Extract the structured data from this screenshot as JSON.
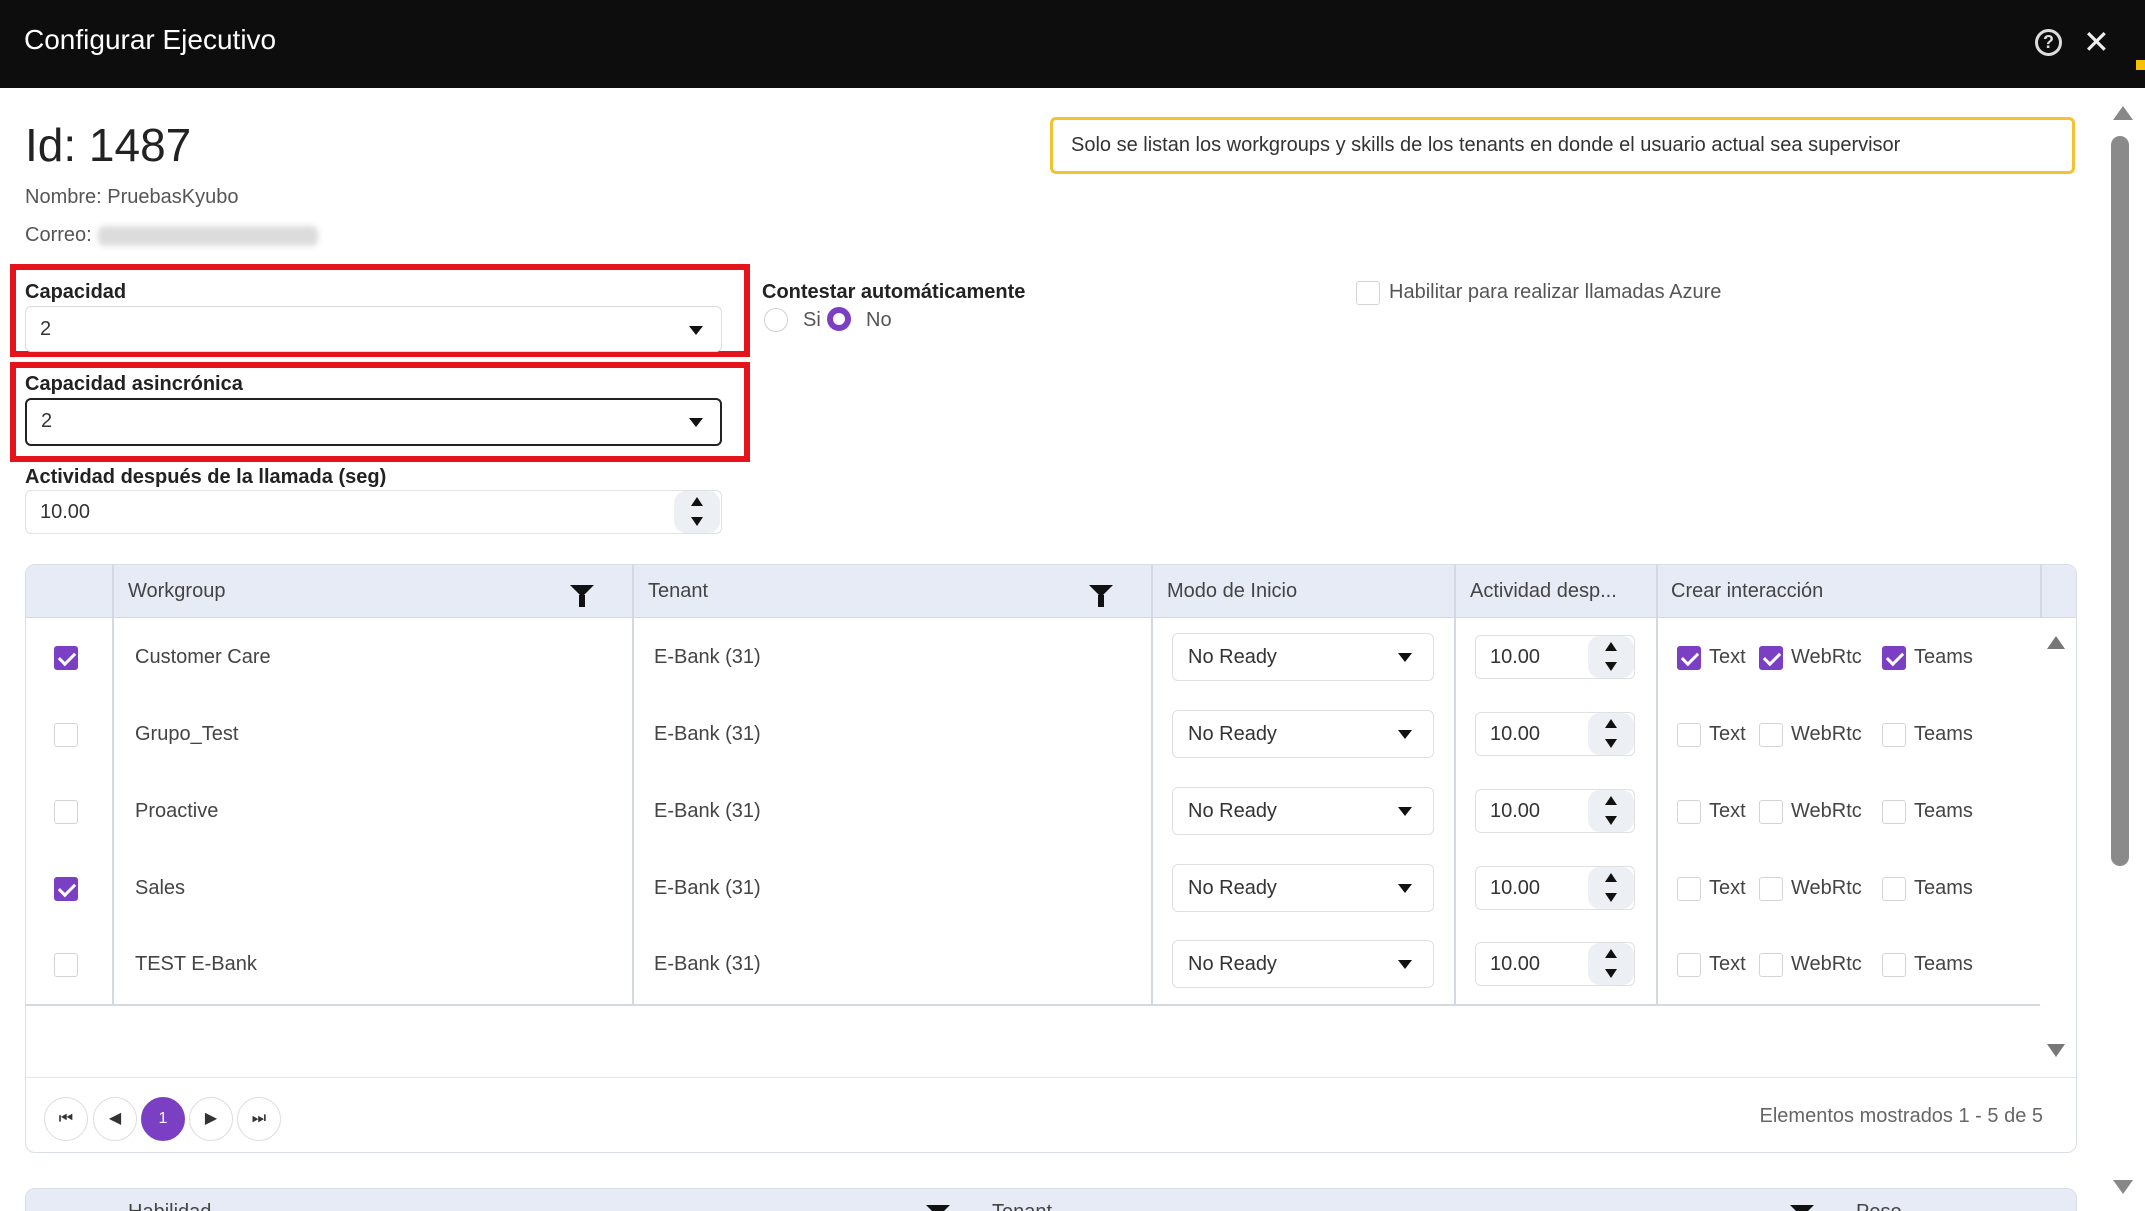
{
  "window": {
    "title": "Configurar Ejecutivo",
    "help_icon": "help-circle-icon",
    "close_icon": "close-icon"
  },
  "header": {
    "id_text": "Id: 1487",
    "name_text": "Nombre: PruebasKyubo",
    "email_label": "Correo:",
    "notice": "Solo se listan los workgroups y skills de los tenants en donde el usuario actual sea supervisor"
  },
  "form": {
    "capacidad": {
      "label": "Capacidad",
      "value": "2"
    },
    "capacidad_async": {
      "label": "Capacidad asincrónica",
      "value": "2"
    },
    "actividad": {
      "label": "Actividad después de la llamada (seg)",
      "value": "10.00"
    },
    "contestar": {
      "label": "Contestar automáticamente",
      "options": [
        "Si",
        "No"
      ],
      "selected": "No"
    },
    "azure": {
      "label": "Habilitar para realizar llamadas Azure",
      "checked": false
    }
  },
  "grid": {
    "columns": [
      "Workgroup",
      "Tenant",
      "Modo de Inicio",
      "Actividad desp...",
      "Crear interacción"
    ],
    "channel_labels": [
      "Text",
      "WebRtc",
      "Teams"
    ],
    "rows": [
      {
        "selected": true,
        "workgroup": "Customer Care",
        "tenant": "E-Bank (31)",
        "modo": "No Ready",
        "actividad": "10.00",
        "text": true,
        "webrtc": true,
        "teams": true
      },
      {
        "selected": false,
        "workgroup": "Grupo_Test",
        "tenant": "E-Bank (31)",
        "modo": "No Ready",
        "actividad": "10.00",
        "text": false,
        "webrtc": false,
        "teams": false
      },
      {
        "selected": false,
        "workgroup": "Proactive",
        "tenant": "E-Bank (31)",
        "modo": "No Ready",
        "actividad": "10.00",
        "text": false,
        "webrtc": false,
        "teams": false
      },
      {
        "selected": true,
        "workgroup": "Sales",
        "tenant": "E-Bank (31)",
        "modo": "No Ready",
        "actividad": "10.00",
        "text": false,
        "webrtc": false,
        "teams": false
      },
      {
        "selected": false,
        "workgroup": "TEST E-Bank",
        "tenant": "E-Bank (31)",
        "modo": "No Ready",
        "actividad": "10.00",
        "text": false,
        "webrtc": false,
        "teams": false
      }
    ],
    "pager": {
      "current_page": "1",
      "summary": "Elementos mostrados 1 - 5 de 5"
    }
  },
  "grid2": {
    "columns": [
      "Habilidad",
      "Tenant",
      "Peso"
    ]
  },
  "colors": {
    "accent": "#7b3fc4",
    "highlight": "#e5131b",
    "notice_border": "#f2c230",
    "titlebar": "#0d0d0d"
  }
}
